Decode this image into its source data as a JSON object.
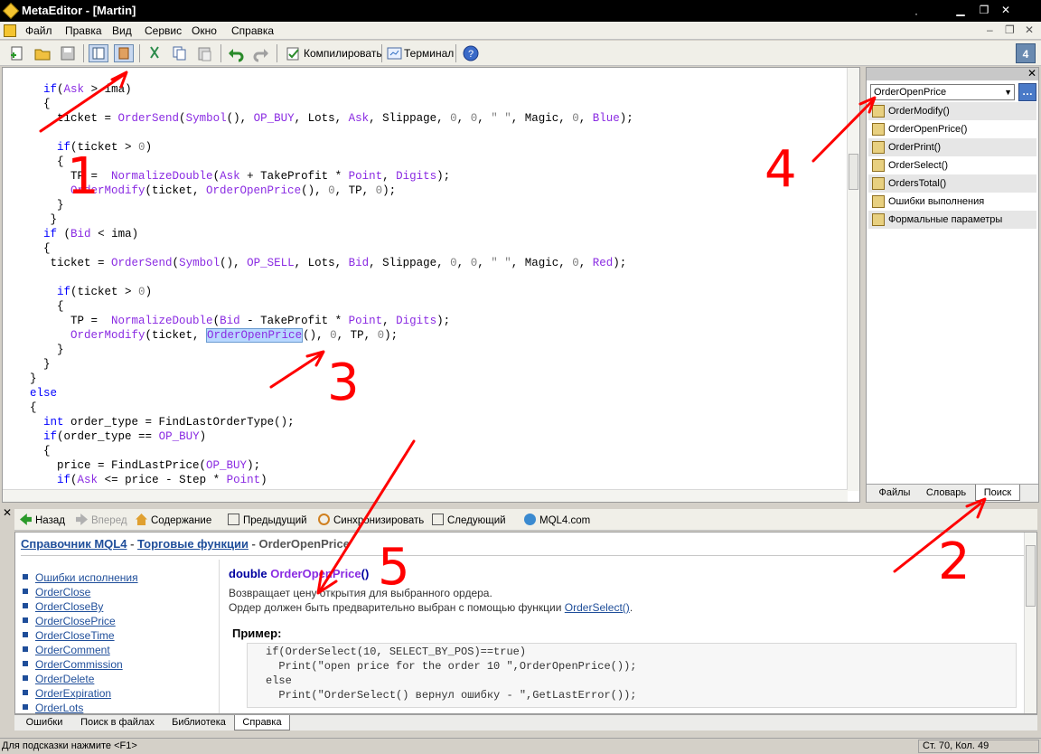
{
  "window": {
    "title": "MetaEditor - [Martin]"
  },
  "menu": [
    "Файл",
    "Правка",
    "Вид",
    "Сервис",
    "Окно",
    "Справка"
  ],
  "toolbar": {
    "compile_label": "Компилировать",
    "terminal_label": "Терминал",
    "badge": "4"
  },
  "code_lines": [
    [
      {
        "t": "      "
      },
      {
        "t": "if",
        "c": "kw"
      },
      {
        "t": "("
      },
      {
        "t": "Ask",
        "c": "var"
      },
      {
        "t": " > ima)"
      }
    ],
    [
      {
        "t": "      {"
      }
    ],
    [
      {
        "t": "        ticket = "
      },
      {
        "t": "OrderSend",
        "c": "fn"
      },
      {
        "t": "("
      },
      {
        "t": "Symbol",
        "c": "fn"
      },
      {
        "t": "(), "
      },
      {
        "t": "OP_BUY",
        "c": "con"
      },
      {
        "t": ", Lots, "
      },
      {
        "t": "Ask",
        "c": "var"
      },
      {
        "t": ", Slippage, "
      },
      {
        "t": "0",
        "c": "num"
      },
      {
        "t": ", "
      },
      {
        "t": "0",
        "c": "num"
      },
      {
        "t": ", "
      },
      {
        "t": "\" \"",
        "c": "str"
      },
      {
        "t": ", Magic, "
      },
      {
        "t": "0",
        "c": "num"
      },
      {
        "t": ", "
      },
      {
        "t": "Blue",
        "c": "con"
      },
      {
        "t": ");"
      }
    ],
    [
      {
        "t": ""
      }
    ],
    [
      {
        "t": "        "
      },
      {
        "t": "if",
        "c": "kw"
      },
      {
        "t": "(ticket > "
      },
      {
        "t": "0",
        "c": "num"
      },
      {
        "t": ")"
      }
    ],
    [
      {
        "t": "        {"
      }
    ],
    [
      {
        "t": "          TP =  "
      },
      {
        "t": "NormalizeDouble",
        "c": "fn"
      },
      {
        "t": "("
      },
      {
        "t": "Ask",
        "c": "var"
      },
      {
        "t": " + TakeProfit * "
      },
      {
        "t": "Point",
        "c": "var"
      },
      {
        "t": ", "
      },
      {
        "t": "Digits",
        "c": "var"
      },
      {
        "t": ");"
      }
    ],
    [
      {
        "t": "          "
      },
      {
        "t": "OrderModify",
        "c": "fn"
      },
      {
        "t": "(ticket, "
      },
      {
        "t": "OrderOpenPrice",
        "c": "fn"
      },
      {
        "t": "(), "
      },
      {
        "t": "0",
        "c": "num"
      },
      {
        "t": ", TP, "
      },
      {
        "t": "0",
        "c": "num"
      },
      {
        "t": ");"
      }
    ],
    [
      {
        "t": "        }"
      }
    ],
    [
      {
        "t": "       }"
      }
    ],
    [
      {
        "t": "      "
      },
      {
        "t": "if",
        "c": "kw"
      },
      {
        "t": " ("
      },
      {
        "t": "Bid",
        "c": "var"
      },
      {
        "t": " < ima)"
      }
    ],
    [
      {
        "t": "      {"
      }
    ],
    [
      {
        "t": "       ticket = "
      },
      {
        "t": "OrderSend",
        "c": "fn"
      },
      {
        "t": "("
      },
      {
        "t": "Symbol",
        "c": "fn"
      },
      {
        "t": "(), "
      },
      {
        "t": "OP_SELL",
        "c": "con"
      },
      {
        "t": ", Lots, "
      },
      {
        "t": "Bid",
        "c": "var"
      },
      {
        "t": ", Slippage, "
      },
      {
        "t": "0",
        "c": "num"
      },
      {
        "t": ", "
      },
      {
        "t": "0",
        "c": "num"
      },
      {
        "t": ", "
      },
      {
        "t": "\" \"",
        "c": "str"
      },
      {
        "t": ", Magic, "
      },
      {
        "t": "0",
        "c": "num"
      },
      {
        "t": ", "
      },
      {
        "t": "Red",
        "c": "con"
      },
      {
        "t": ");"
      }
    ],
    [
      {
        "t": ""
      }
    ],
    [
      {
        "t": "        "
      },
      {
        "t": "if",
        "c": "kw"
      },
      {
        "t": "(ticket > "
      },
      {
        "t": "0",
        "c": "num"
      },
      {
        "t": ")"
      }
    ],
    [
      {
        "t": "        {"
      }
    ],
    [
      {
        "t": "          TP =  "
      },
      {
        "t": "NormalizeDouble",
        "c": "fn"
      },
      {
        "t": "("
      },
      {
        "t": "Bid",
        "c": "var"
      },
      {
        "t": " - TakeProfit * "
      },
      {
        "t": "Point",
        "c": "var"
      },
      {
        "t": ", "
      },
      {
        "t": "Digits",
        "c": "var"
      },
      {
        "t": ");"
      }
    ],
    [
      {
        "t": "          "
      },
      {
        "t": "OrderModify",
        "c": "fn"
      },
      {
        "t": "(ticket, "
      },
      {
        "t": "OrderOpenPrice",
        "c": "fn hl"
      },
      {
        "t": "(), "
      },
      {
        "t": "0",
        "c": "num"
      },
      {
        "t": ", TP, "
      },
      {
        "t": "0",
        "c": "num"
      },
      {
        "t": ");"
      }
    ],
    [
      {
        "t": "        }"
      }
    ],
    [
      {
        "t": "      }"
      }
    ],
    [
      {
        "t": "    }"
      }
    ],
    [
      {
        "t": "    "
      },
      {
        "t": "else",
        "c": "kw"
      }
    ],
    [
      {
        "t": "    {"
      }
    ],
    [
      {
        "t": "      "
      },
      {
        "t": "int",
        "c": "kw"
      },
      {
        "t": " order_type = FindLastOrderType();"
      }
    ],
    [
      {
        "t": "      "
      },
      {
        "t": "if",
        "c": "kw"
      },
      {
        "t": "(order_type == "
      },
      {
        "t": "OP_BUY",
        "c": "con"
      },
      {
        "t": ")"
      }
    ],
    [
      {
        "t": "      {"
      }
    ],
    [
      {
        "t": "        price = FindLastPrice("
      },
      {
        "t": "OP_BUY",
        "c": "con"
      },
      {
        "t": ");"
      }
    ],
    [
      {
        "t": "        "
      },
      {
        "t": "if",
        "c": "kw"
      },
      {
        "t": "("
      },
      {
        "t": "Ask",
        "c": "var"
      },
      {
        "t": " <= price - Step * "
      },
      {
        "t": "Point",
        "c": "var"
      },
      {
        "t": ")"
      }
    ]
  ],
  "navigator": {
    "search_value": "OrderOpenPrice",
    "results": [
      "OrderModify()",
      "OrderOpenPrice()",
      "OrderPrint()",
      "OrderSelect()",
      "OrdersTotal()",
      "Ошибки выполнения",
      "Формальные параметры"
    ],
    "tabs": [
      "Файлы",
      "Словарь",
      "Поиск"
    ],
    "active_tab": "Поиск"
  },
  "help_toolbar": {
    "back": "Назад",
    "forward": "Вперед",
    "contents": "Содержание",
    "prev": "Предыдущий",
    "sync": "Синхронизировать",
    "next": "Следующий",
    "site": "MQL4.com"
  },
  "help": {
    "crumb1": "Справочник MQL4",
    "sep1": " - ",
    "crumb2": "Торговые функции",
    "sep2": " - ",
    "current": "OrderOpenPrice",
    "list": [
      "Ошибки исполнения",
      "OrderClose",
      "OrderCloseBy",
      "OrderClosePrice",
      "OrderCloseTime",
      "OrderComment",
      "OrderCommission",
      "OrderDelete",
      "OrderExpiration",
      "OrderLots"
    ],
    "sig_type": "double ",
    "sig_name": "OrderOpenPrice",
    "sig_parens": "()",
    "desc1": "Возвращает цену открытия для выбранного ордера.",
    "desc2_pre": "Ордер должен быть предварительно выбран с помощью функции ",
    "desc2_link": "OrderSelect()",
    "desc2_post": ".",
    "example_label": "Пример:",
    "example_lines": [
      "if(OrderSelect(10, SELECT_BY_POS)==true)",
      "  Print(\"open price for the order 10 \",OrderOpenPrice());",
      "else",
      "  Print(\"OrderSelect() вернул ошибку - \",GetLastError());"
    ]
  },
  "help_tabs": [
    "Ошибки",
    "Поиск в файлах",
    "Библиотека",
    "Справка"
  ],
  "help_active_tab": "Справка",
  "status": {
    "hint": "Для подсказки нажмите <F1>",
    "position": "Ст. 70, Кол. 49"
  },
  "annotations": [
    "1",
    "2",
    "3",
    "4",
    "5"
  ],
  "colors": {
    "keyword": "#0000ff",
    "function": "#8a2be2",
    "annotation": "#ff0000",
    "link": "#1f4e9a"
  }
}
